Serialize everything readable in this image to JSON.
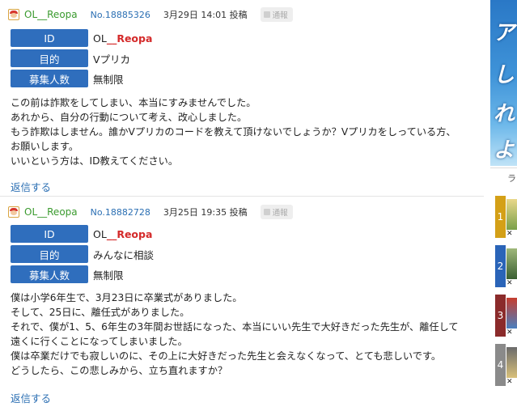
{
  "posts": [
    {
      "username": "OL__Reopa",
      "post_no": "No.18885326",
      "date": "3月29日 14:01 投稿",
      "report_label": "通報",
      "meta": [
        {
          "key": "ID",
          "value": "OL__Reopa",
          "highlight": true
        },
        {
          "key": "目的",
          "value": "Vプリカ",
          "highlight": false
        },
        {
          "key": "募集人数",
          "value": "無制限",
          "highlight": false
        }
      ],
      "body": [
        "この前は詐欺をしてしまい、本当にすみませんでした。",
        "あれから、自分の行動について考え、改心しました。",
        "もう詐欺はしません。誰かVプリカのコードを教えて頂けないでしょうか？Vプリカをしっている方、",
        "お願いします。",
        "いいという方は、ID教えてください。"
      ],
      "reply_label": "返信する"
    },
    {
      "username": "OL__Reopa",
      "post_no": "No.18882728",
      "date": "3月25日 19:35 投稿",
      "report_label": "通報",
      "meta": [
        {
          "key": "ID",
          "value": "OL__Reopa",
          "highlight": true
        },
        {
          "key": "目的",
          "value": "みんなに相談",
          "highlight": false
        },
        {
          "key": "募集人数",
          "value": "無制限",
          "highlight": false
        }
      ],
      "body": [
        "僕は小学6年生で、3月23日に卒業式がありました。",
        "そして、25日に、離任式がありました。",
        "それで、僕が1、5、6年生の3年間お世話になった、本当にいい先生で大好きだった先生が、離任して",
        "遠くに行くことになってしまいました。",
        "僕は卒業だけでも寂しいのに、その上に大好きだった先生と会えなくなって、とても悲しいです。",
        "どうしたら、この悲しみから、立ち直れますか？"
      ],
      "reply_label": "返信する"
    }
  ],
  "sidebar": {
    "banner_chars": [
      "ア",
      "し",
      "れ",
      "よ"
    ],
    "ranking_header": "ラ",
    "rankings": [
      {
        "num": "1",
        "color": "#d4a017"
      },
      {
        "num": "2",
        "color": "#2a64b8"
      },
      {
        "num": "3",
        "color": "#8b2b2b"
      },
      {
        "num": "4",
        "color": "#8a8a8a"
      }
    ]
  }
}
